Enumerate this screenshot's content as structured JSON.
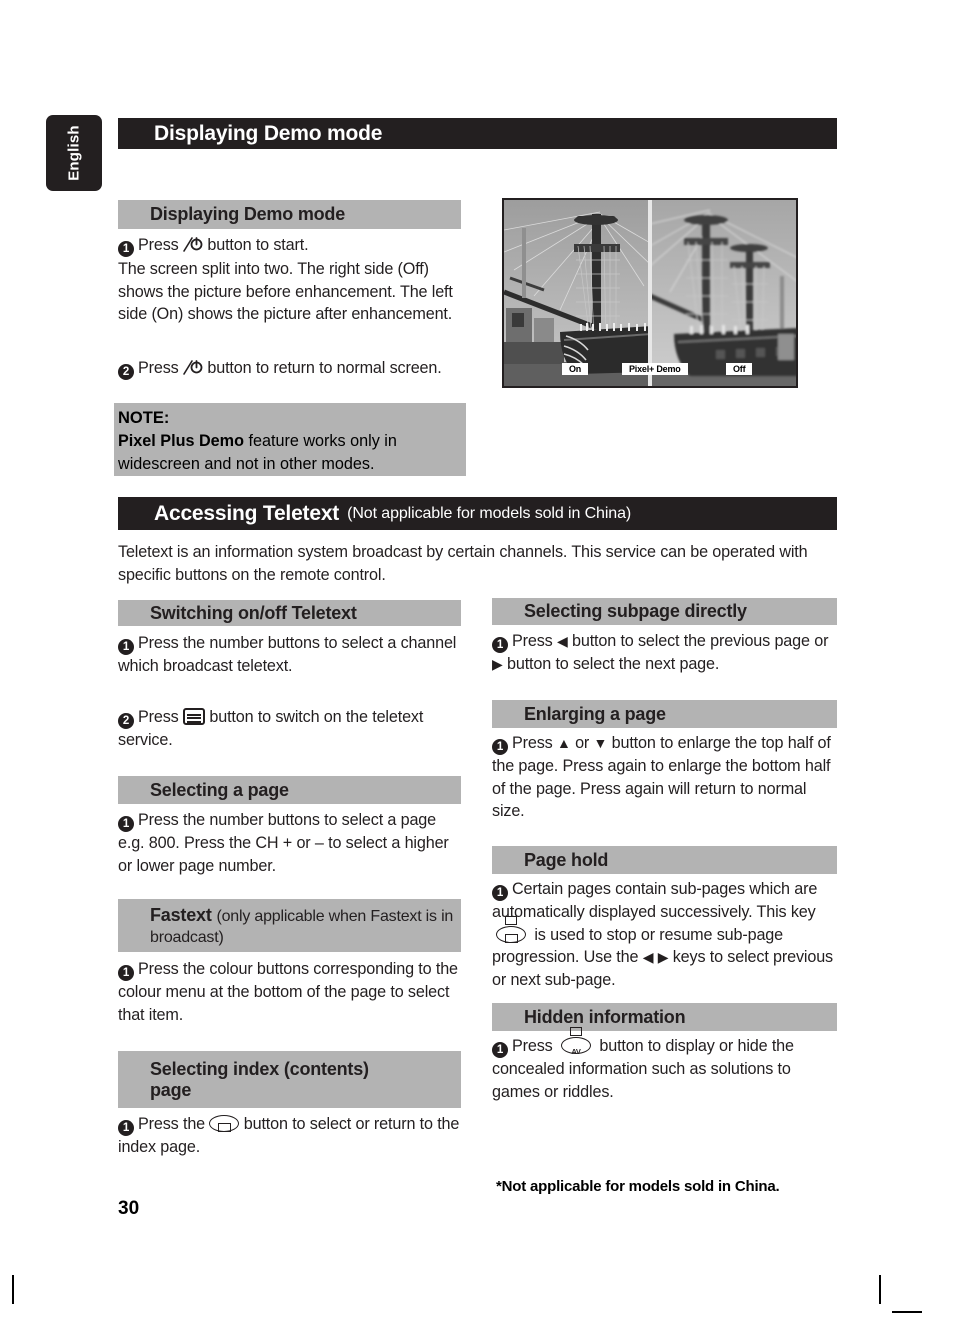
{
  "language_tab": "English",
  "demo_section": {
    "bar_title": "Displaying Demo mode",
    "heading": "Displaying Demo mode",
    "step1": "Press",
    "step1_tail": "button to start.",
    "step1_body": "The screen split into two. The right side (Off) shows the picture before enhancement. The left side (On) shows the picture after enhancement.",
    "step2": "Press",
    "step2_tail": "button to return to normal screen.",
    "note_title": "NOTE:",
    "note_bold": "Pixel Plus Demo",
    "note_rest": " feature works only in widescreen and not in other modes.",
    "photo": {
      "osd_on": "On",
      "osd_center": "Pixel+ Demo",
      "osd_off": "Off"
    }
  },
  "teletext_section": {
    "bar_title": "Accessing Teletext",
    "bar_subtitle": "(Not applicable for models sold in China)",
    "intro": "Teletext is an information system broadcast by certain channels.  This service can be operated with specific buttons on the remote control.",
    "left": {
      "switching_heading": "Switching on/off Teletext",
      "switching_step1": "Press the number buttons to select a channel which broadcast teletext.",
      "switching_step2_pre": "Press",
      "switching_step2_post": "button to switch on the teletext service.",
      "selecting_page_heading": "Selecting a page",
      "selecting_page_step1": "Press the number buttons to select a page e.g. 800.  Press the CH + or – to select a higher or lower page number.",
      "fastext_heading": "Fastext",
      "fastext_sub": "(only applicable when Fastext is in broadcast)",
      "fastext_step1": "Press the colour buttons corresponding to the colour menu at the bottom of the page to select that item.",
      "index_heading_line1": "Selecting index (contents)",
      "index_heading_line2": "page",
      "index_step1_pre": "Press the",
      "index_step1_post": "button to select or return to the index page."
    },
    "right": {
      "subpage_heading": "Selecting subpage directly",
      "subpage_step1_a": "Press",
      "subpage_step1_b": "button to select the previous page or",
      "subpage_step1_c": "button to select the next page.",
      "enlarging_heading": "Enlarging a page",
      "enlarging_step1_a": "Press",
      "enlarging_step1_or": "or",
      "enlarging_step1_b": "button to enlarge the top half of the page. Press again to enlarge the bottom half of the page. Press again will return to normal size.",
      "pagehold_heading": "Page hold",
      "pagehold_step1_a": "Certain pages contain sub-pages which are automatically displayed successively. This key",
      "pagehold_step1_b": "is used to stop or resume sub-page progression. Use the",
      "pagehold_step1_c": "keys to select previous or next sub-page.",
      "hidden_heading": "Hidden information",
      "hidden_step1_pre": "Press",
      "hidden_step1_post": "button to display or hide the concealed information such as solutions to games or riddles.",
      "av_key_label": "AV"
    }
  },
  "footnote": "*Not applicable for models sold in China.",
  "page_number": "30",
  "numbers": {
    "one": "1",
    "two": "2"
  },
  "arrows": {
    "left": "◀",
    "right": "▶",
    "up": "▲",
    "down": "▼"
  },
  "colors": {
    "bar": "#231f20",
    "gray_head": "#b3b3b3",
    "text": "#231f20",
    "page": "#ffffff"
  }
}
